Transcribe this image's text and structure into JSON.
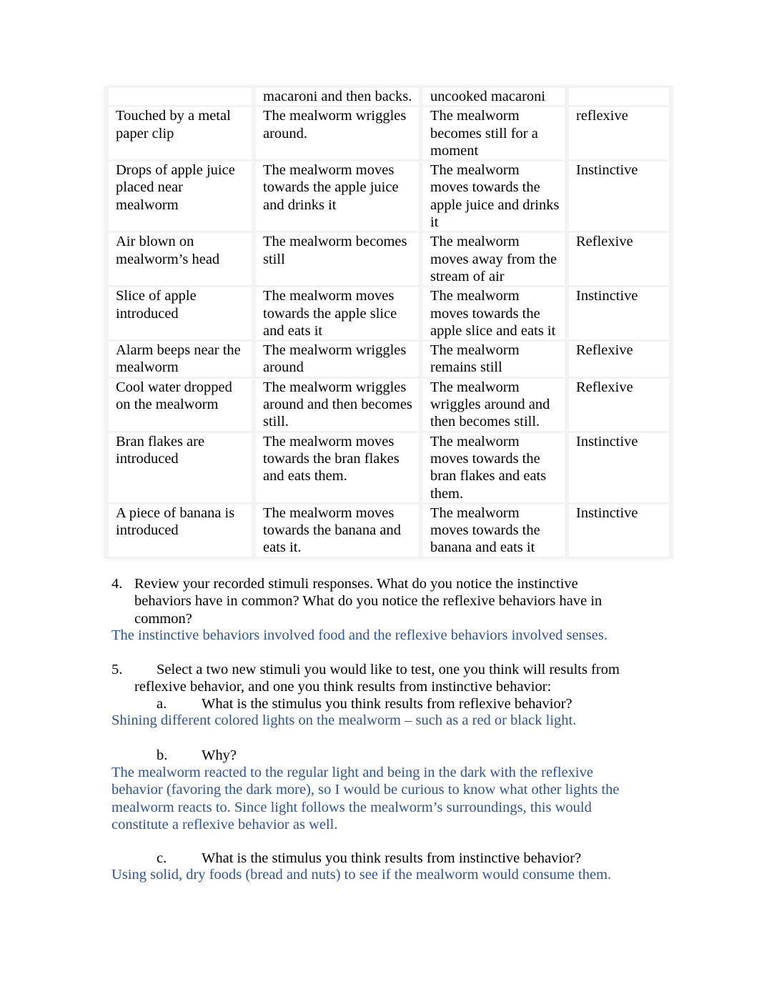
{
  "table": {
    "rows": [
      {
        "stimulus": "",
        "hypothesis": "macaroni and then backs.",
        "observation": "uncooked macaroni",
        "behavior": ""
      },
      {
        "stimulus": "Touched by a metal paper clip",
        "hypothesis": "The mealworm wriggles around.",
        "observation": "The mealworm becomes still for a moment",
        "behavior": "reflexive"
      },
      {
        "stimulus": "Drops of apple juice placed near mealworm",
        "hypothesis": "The mealworm moves towards the apple juice and drinks it",
        "observation": "The mealworm moves towards the apple juice and drinks it",
        "behavior": "Instinctive"
      },
      {
        "stimulus": "Air blown on mealworm’s head",
        "hypothesis": "The mealworm becomes still",
        "observation": "The mealworm moves away from the stream of air",
        "behavior": "Reflexive"
      },
      {
        "stimulus": "Slice of apple introduced",
        "hypothesis": "The mealworm moves towards the apple slice and eats it",
        "observation": "The mealworm moves towards the apple slice and eats it",
        "behavior": "Instinctive"
      },
      {
        "stimulus": "Alarm beeps near the mealworm",
        "hypothesis": "The mealworm wriggles around",
        "observation": "The mealworm remains still",
        "behavior": "Reflexive"
      },
      {
        "stimulus": "Cool water dropped on the mealworm",
        "hypothesis": "The mealworm wriggles around and then becomes still.",
        "observation": "The mealworm wriggles around and then becomes still.",
        "behavior": "Reflexive"
      },
      {
        "stimulus": "Bran flakes are introduced",
        "hypothesis": "The mealworm moves towards the bran flakes and eats them.",
        "observation": "The mealworm moves towards the bran flakes and eats them.",
        "behavior": "Instinctive"
      },
      {
        "stimulus": "A piece of banana is introduced",
        "hypothesis": "The mealworm moves towards the banana and eats it.",
        "observation": "The mealworm moves towards the banana and eats it",
        "behavior": "Instinctive"
      }
    ]
  },
  "q4": {
    "number": "4.",
    "line1": "Review your recorded stimuli responses.  What do you notice the instinctive",
    "line2": "behaviors have in common? What do you notice the reflexive behaviors have in",
    "line3": "common?",
    "answer": "The instinctive behaviors involved food and the reflexive behaviors involved senses."
  },
  "q5": {
    "number": "5.",
    "line1": "Select a two new stimuli you would like to test, one you think will results from",
    "line2": "reflexive behavior, and one you think results from instinctive behavior:",
    "a": {
      "letter": "a.",
      "question": "What is the stimulus you think results from reflexive behavior?",
      "answer": "Shining different colored lights on the mealworm – such as a red or black light."
    },
    "b": {
      "letter": "b.",
      "question": "Why?",
      "answer_lines": [
        "The mealworm reacted to the regular light and being in the dark with the reflexive",
        "behavior (favoring the dark more), so I would be curious to know what other lights the",
        "mealworm reacts to. Since light follows the mealworm’s surroundings, this would",
        "constitute a reflexive behavior as well."
      ]
    },
    "c": {
      "letter": "c.",
      "question": "What is the stimulus you think results from instinctive behavior?",
      "answer": "Using solid, dry foods (bread and nuts) to see if the mealworm would consume them."
    }
  },
  "colors": {
    "answer_text": "#2e5496",
    "body_text": "#000000",
    "table_border": "#f3f3f3"
  }
}
